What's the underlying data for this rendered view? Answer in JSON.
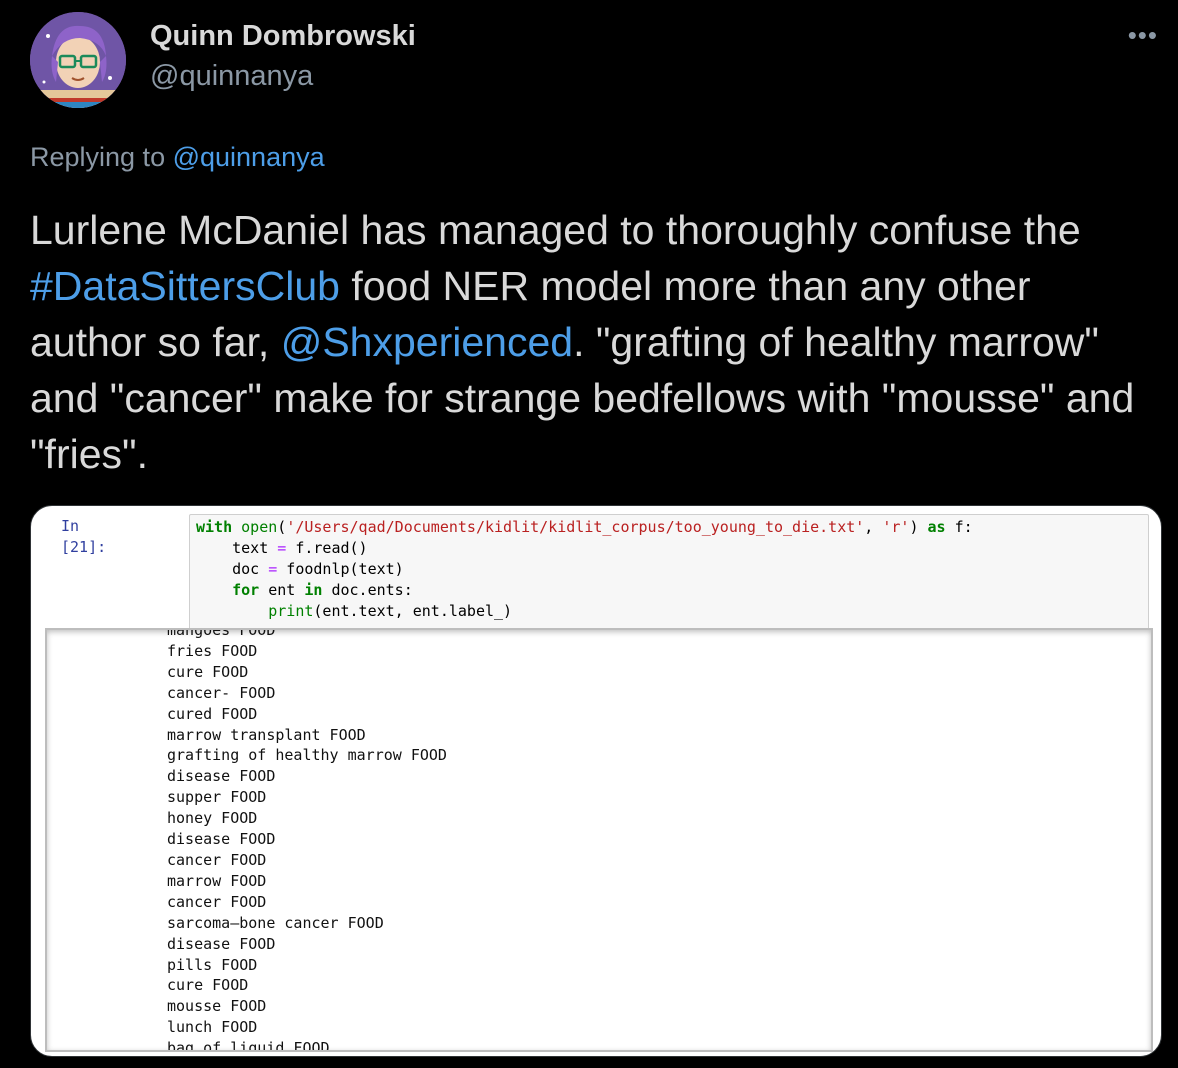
{
  "author": {
    "name": "Quinn Dombrowski",
    "handle": "@quinnanya"
  },
  "more_menu": "•••",
  "reply": {
    "prefix": "Replying to ",
    "handle": "@quinnanya"
  },
  "tweet": {
    "part1": "Lurlene McDaniel has managed to thoroughly confuse the ",
    "hashtag": "#DataSittersClub",
    "part2": " food NER model more than any other author so far, ",
    "mention": "@Shxperienced",
    "part3": ". \"grafting of healthy marrow\" and \"cancer\" make for strange bedfellows with \"mousse\" and \"fries\"."
  },
  "notebook": {
    "prompt": "In [21]:",
    "code": {
      "l1_kw": "with",
      "l1_fn": "open",
      "l1_p1": "(",
      "l1_str1": "'/Users/qad/Documents/kidlit/kidlit_corpus/too_young_to_die.txt'",
      "l1_p2": ", ",
      "l1_str2": "'r'",
      "l1_p3": ") ",
      "l1_as": "as",
      "l1_p4": " f:",
      "l2_a": "    text ",
      "l2_op": "=",
      "l2_b": " f.read()",
      "l3_a": "    doc ",
      "l3_op": "=",
      "l3_b": " foodnlp(text)",
      "l4_for": "for",
      "l4_a": " ent ",
      "l4_in": "in",
      "l4_b": " doc.ents:",
      "l5_fn": "print",
      "l5_b": "(ent.text, ent.label_)"
    },
    "output": [
      "mangoes FOOD",
      "fries FOOD",
      "cure FOOD",
      "cancer- FOOD",
      "cured FOOD",
      "marrow transplant FOOD",
      "grafting of healthy marrow FOOD",
      "disease FOOD",
      "supper FOOD",
      "honey FOOD",
      "disease FOOD",
      "cancer FOOD",
      "marrow FOOD",
      "cancer FOOD",
      "sarcoma—bone cancer FOOD",
      "disease FOOD",
      "pills FOOD",
      "cure FOOD",
      "mousse FOOD",
      "lunch FOOD",
      "bag of liquid FOOD"
    ]
  }
}
